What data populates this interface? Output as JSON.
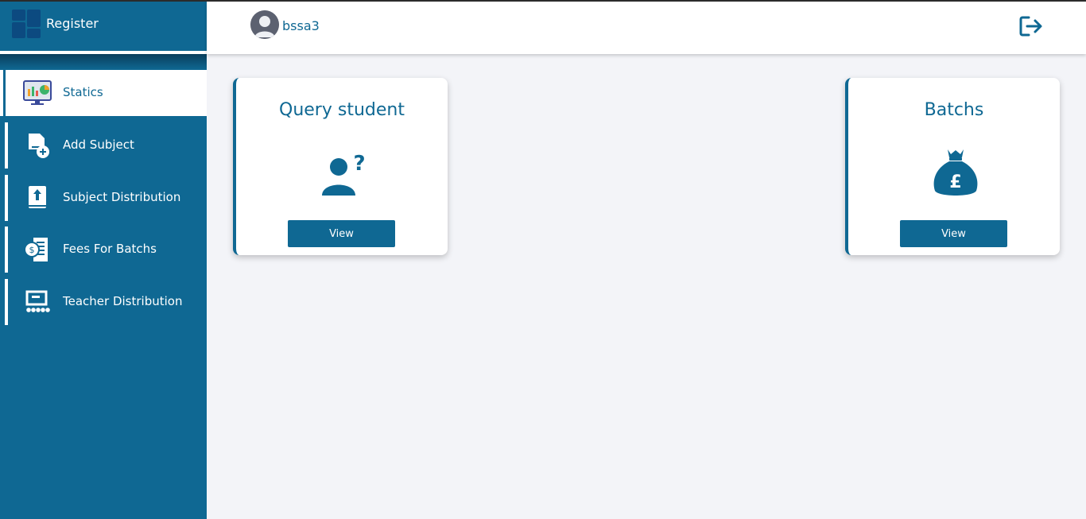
{
  "app": {
    "brand": "Register"
  },
  "header": {
    "username": "bssa3"
  },
  "sidebar": {
    "items": [
      {
        "label": "Statics",
        "icon": "statistics-monitor-icon",
        "active": true
      },
      {
        "label": "Add Subject",
        "icon": "add-document-icon",
        "active": false
      },
      {
        "label": "Subject Distribution",
        "icon": "upload-book-icon",
        "active": false
      },
      {
        "label": "Fees For Batchs",
        "icon": "fees-receipt-icon",
        "active": false
      },
      {
        "label": "Teacher Distribution",
        "icon": "teacher-board-icon",
        "active": false
      }
    ]
  },
  "cards": [
    {
      "title": "Query student",
      "icon": "user-question-icon",
      "button": "View"
    },
    {
      "title": "Batchs",
      "icon": "money-bag-pound-icon",
      "button": "View"
    }
  ],
  "colors": {
    "primary": "#0f6893",
    "background": "#f3f4f8",
    "logo": "#0c4a80"
  }
}
